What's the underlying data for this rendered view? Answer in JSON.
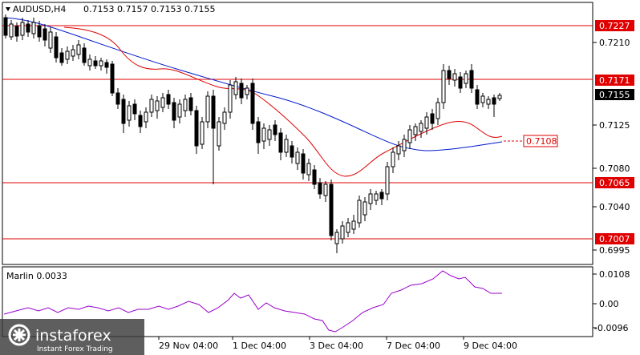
{
  "header": {
    "symbol": "AUDUSD,H4",
    "ohlc": "0.7153 0.7157 0.7153 0.7155"
  },
  "indicator": {
    "label": "Marlin 0.0033",
    "scale": [
      "0.0108",
      "0.00",
      "-0.0096"
    ],
    "color": "#9900cc"
  },
  "price_scale": [
    "0.7210",
    "0.7125",
    "0.7080",
    "0.7040",
    "0.6995"
  ],
  "levels": [
    {
      "value": "0.7227",
      "style": "filled"
    },
    {
      "value": "0.7171",
      "style": "filled"
    },
    {
      "value": "0.7065",
      "style": "filled"
    },
    {
      "value": "0.7007",
      "style": "filled"
    },
    {
      "value": "0.7108",
      "style": "outline"
    }
  ],
  "current_price": "0.7155",
  "time_axis": [
    "29 Nov 04:00",
    "1 Dec 04:00",
    "3 Dec 04:00",
    "7 Dec 04:00",
    "9 Dec 04:00"
  ],
  "colors": {
    "level_line": "#e00000",
    "ma_fast": "#e00000",
    "ma_slow": "#0018cc",
    "candle": "#000000"
  },
  "watermark": {
    "brand": "instaforex",
    "tagline": "Instant Forex Trading"
  }
}
